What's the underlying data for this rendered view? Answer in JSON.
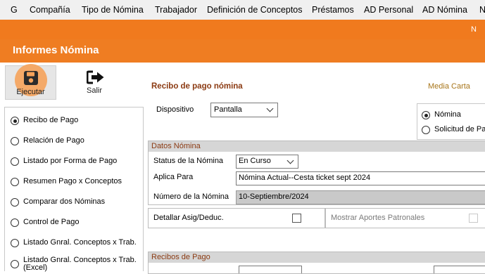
{
  "menubar": {
    "items": [
      "G",
      "Compañía",
      "Tipo de Nómina",
      "Trabajador",
      "Definición de Conceptos",
      "Préstamos",
      "AD Personal",
      "AD Nómina",
      "N"
    ]
  },
  "header": {
    "corner_char": "N",
    "title": "Informes Nómina"
  },
  "toolbar": {
    "ejecutar_label": "Ejecutar",
    "salir_label": "Salir"
  },
  "report_list": {
    "items": [
      {
        "label": "Recibo de Pago",
        "selected": true
      },
      {
        "label": "Relación de Pago",
        "selected": false
      },
      {
        "label": "Listado por Forma de Pago",
        "selected": false
      },
      {
        "label": "Resumen Pago x Conceptos",
        "selected": false
      },
      {
        "label": "Comparar dos Nóminas",
        "selected": false
      },
      {
        "label": "Control de Pago",
        "selected": false
      },
      {
        "label": "Listado Gnral. Conceptos x Trab.",
        "selected": false
      },
      {
        "label": "Listado Gnral. Conceptos x Trab. (Excel)",
        "selected": false
      }
    ]
  },
  "main": {
    "section_title": "Recibo de pago nómina",
    "media_carta": "Media Carta",
    "dispositivo_label": "Dispositivo",
    "dispositivo_value": "Pantalla",
    "tipo_options": [
      {
        "label": "Nómina",
        "selected": true
      },
      {
        "label": "Solicitud de Pag",
        "selected": false
      }
    ],
    "datos_nomina": {
      "header": "Datos Nómina",
      "status_label": "Status de la Nómina",
      "status_value": "En Curso",
      "aplica_label": "Aplica Para",
      "aplica_value": "Nómina Actual--Cesta ticket sept 2024",
      "numero_label": "Número de la  Nómina",
      "numero_value": "10-Septiembre/2024"
    },
    "detallar_label": "Detallar Asig/Deduc.",
    "detallar_checked": false,
    "aportes_label": "Mostrar Aportes Patronales",
    "aportes_checked": false,
    "recibos_header": "Recibos de Pago"
  },
  "colors": {
    "accent": "#ef7d22",
    "section_title": "#8b3a12",
    "media_carta": "#a8761b"
  }
}
